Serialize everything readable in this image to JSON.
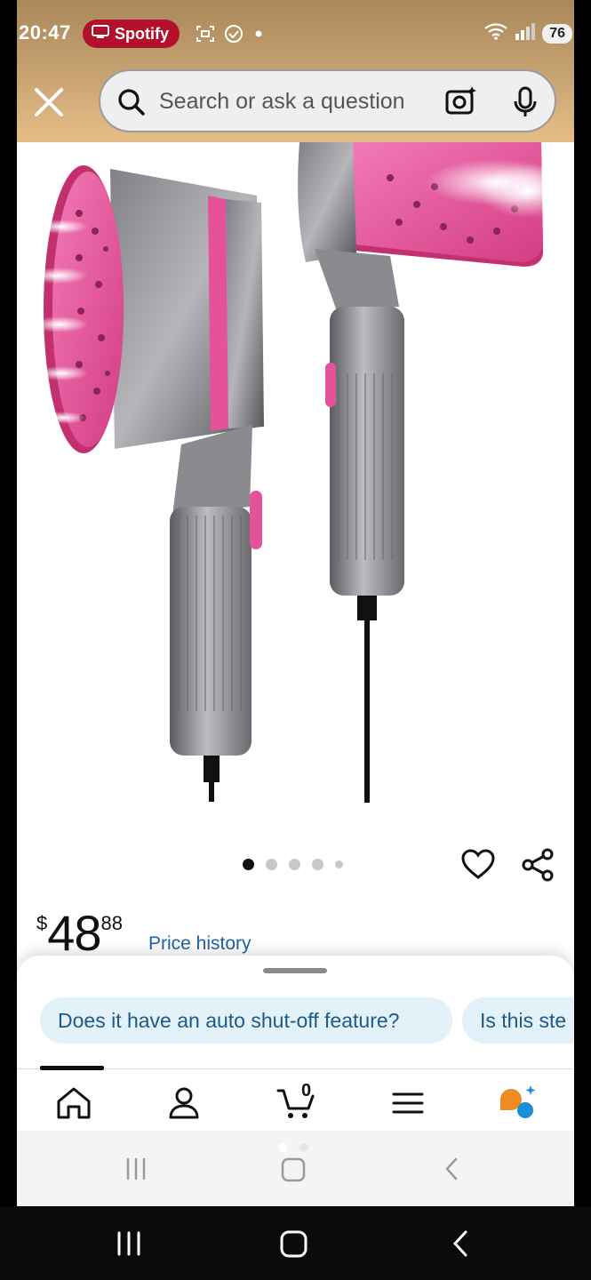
{
  "status_bar": {
    "time": "20:47",
    "notification_app": "Spotify",
    "battery": "76"
  },
  "search": {
    "placeholder": "Search or ask a question"
  },
  "product": {
    "image_alt": "handheld garment steamer, gray with pink steam plate",
    "image_count": 5,
    "active_image_index": 0
  },
  "price": {
    "symbol": "$",
    "whole": "48",
    "fraction": "88",
    "history_link": "Price history"
  },
  "suggestions": [
    "Does it have an auto shut-off feature?",
    "Is this ste"
  ],
  "cart": {
    "count": "0"
  },
  "nav_items": [
    "home-icon",
    "account-icon",
    "cart-icon",
    "menu-icon",
    "ai-assistant-icon"
  ],
  "colors": {
    "header_gradient_top": "#a9885a",
    "header_gradient_bottom": "#e6bd86",
    "spotify_pill": "#b3102c",
    "link": "#2162a1",
    "chip_bg": "#e3f1f8",
    "accent_orange": "#f08a24",
    "accent_blue": "#1a8fd8",
    "steamer_pink": "#e5529a"
  }
}
